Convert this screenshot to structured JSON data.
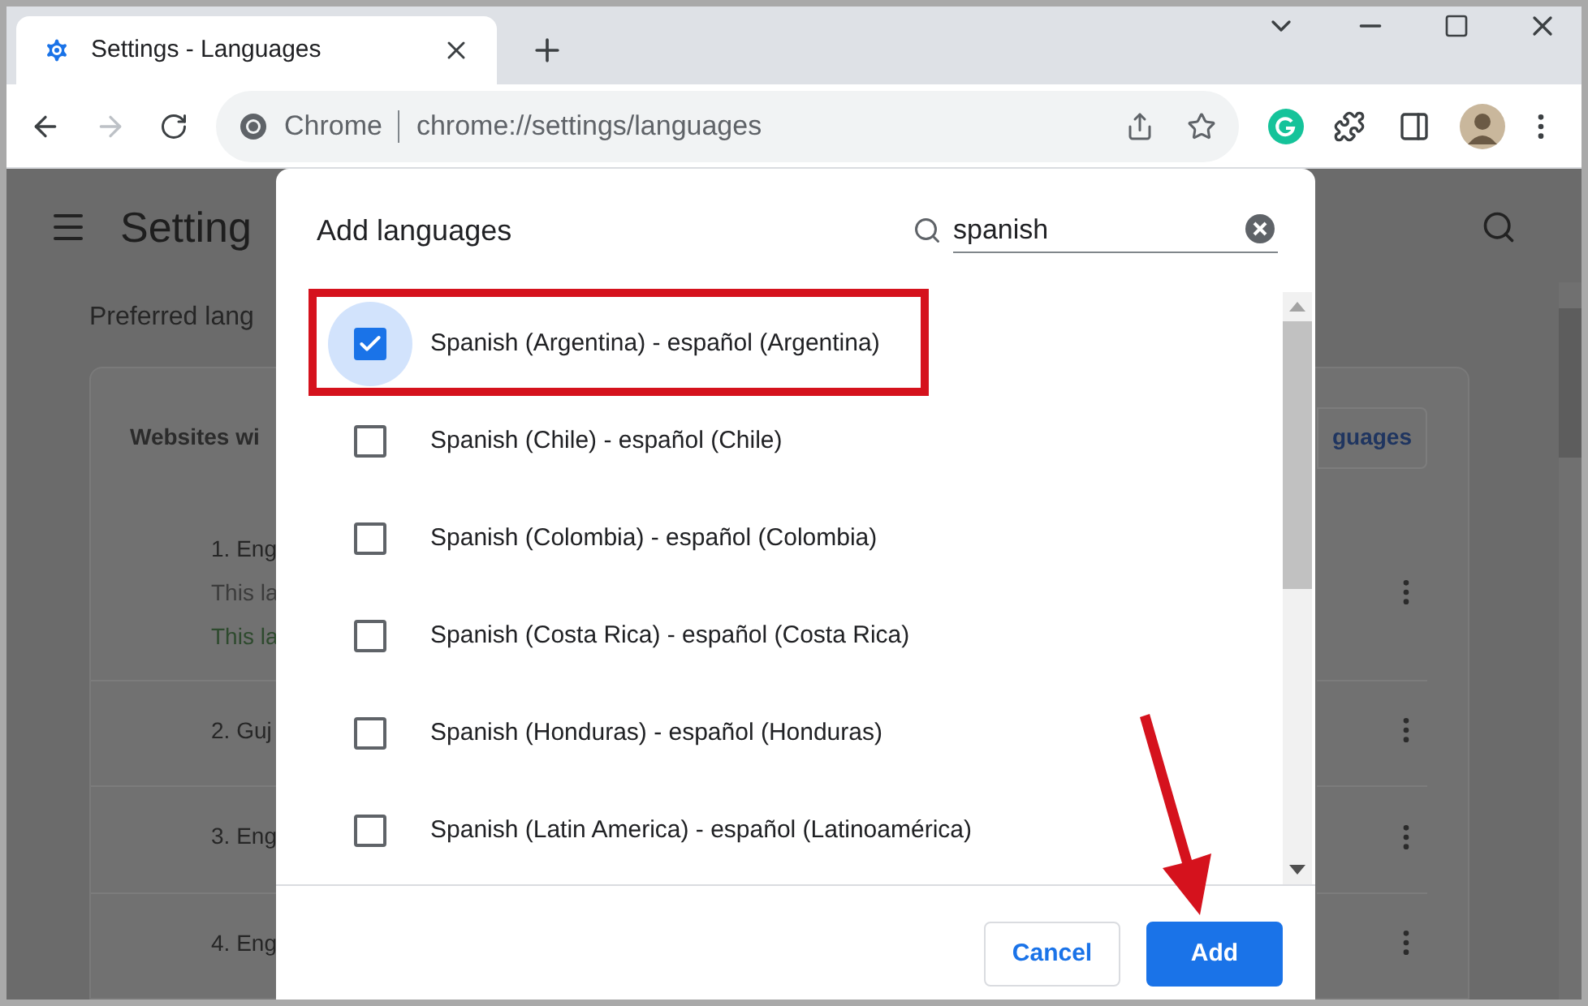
{
  "tab": {
    "title": "Settings - Languages",
    "selected": true
  },
  "toolbar": {
    "forward_disabled": true,
    "chip": "Chrome",
    "url": "chrome://settings/languages"
  },
  "page": {
    "title": "Setting",
    "section": "Preferred lang",
    "card_heading": "Websites wi",
    "card_button": "guages",
    "languages": [
      {
        "label": "1. Eng",
        "notes": [
          {
            "text": "This la",
            "kind": "note"
          },
          {
            "text": "This la",
            "kind": "success"
          }
        ]
      },
      {
        "label": "2. Guj"
      },
      {
        "label": "3. Eng"
      },
      {
        "label": "4. Eng"
      }
    ]
  },
  "dialog": {
    "title": "Add languages",
    "search": {
      "value": "spanish"
    },
    "options": [
      {
        "label": "Spanish (Argentina) - español (Argentina)",
        "checked": true,
        "focused": true,
        "highlighted": true
      },
      {
        "label": "Spanish (Chile) - español (Chile)",
        "checked": false,
        "focused": false,
        "highlighted": false
      },
      {
        "label": "Spanish (Colombia) - español (Colombia)",
        "checked": false,
        "focused": false,
        "highlighted": false
      },
      {
        "label": "Spanish (Costa Rica) - español (Costa Rica)",
        "checked": false,
        "focused": false,
        "highlighted": false
      },
      {
        "label": "Spanish (Honduras) - español (Honduras)",
        "checked": false,
        "focused": false,
        "highlighted": false
      },
      {
        "label": "Spanish (Latin America) - español (Latinoamérica)",
        "checked": false,
        "focused": false,
        "highlighted": false
      }
    ],
    "buttons": [
      {
        "label": "Cancel",
        "kind": "secondary"
      },
      {
        "label": "Add",
        "kind": "primary"
      }
    ]
  }
}
